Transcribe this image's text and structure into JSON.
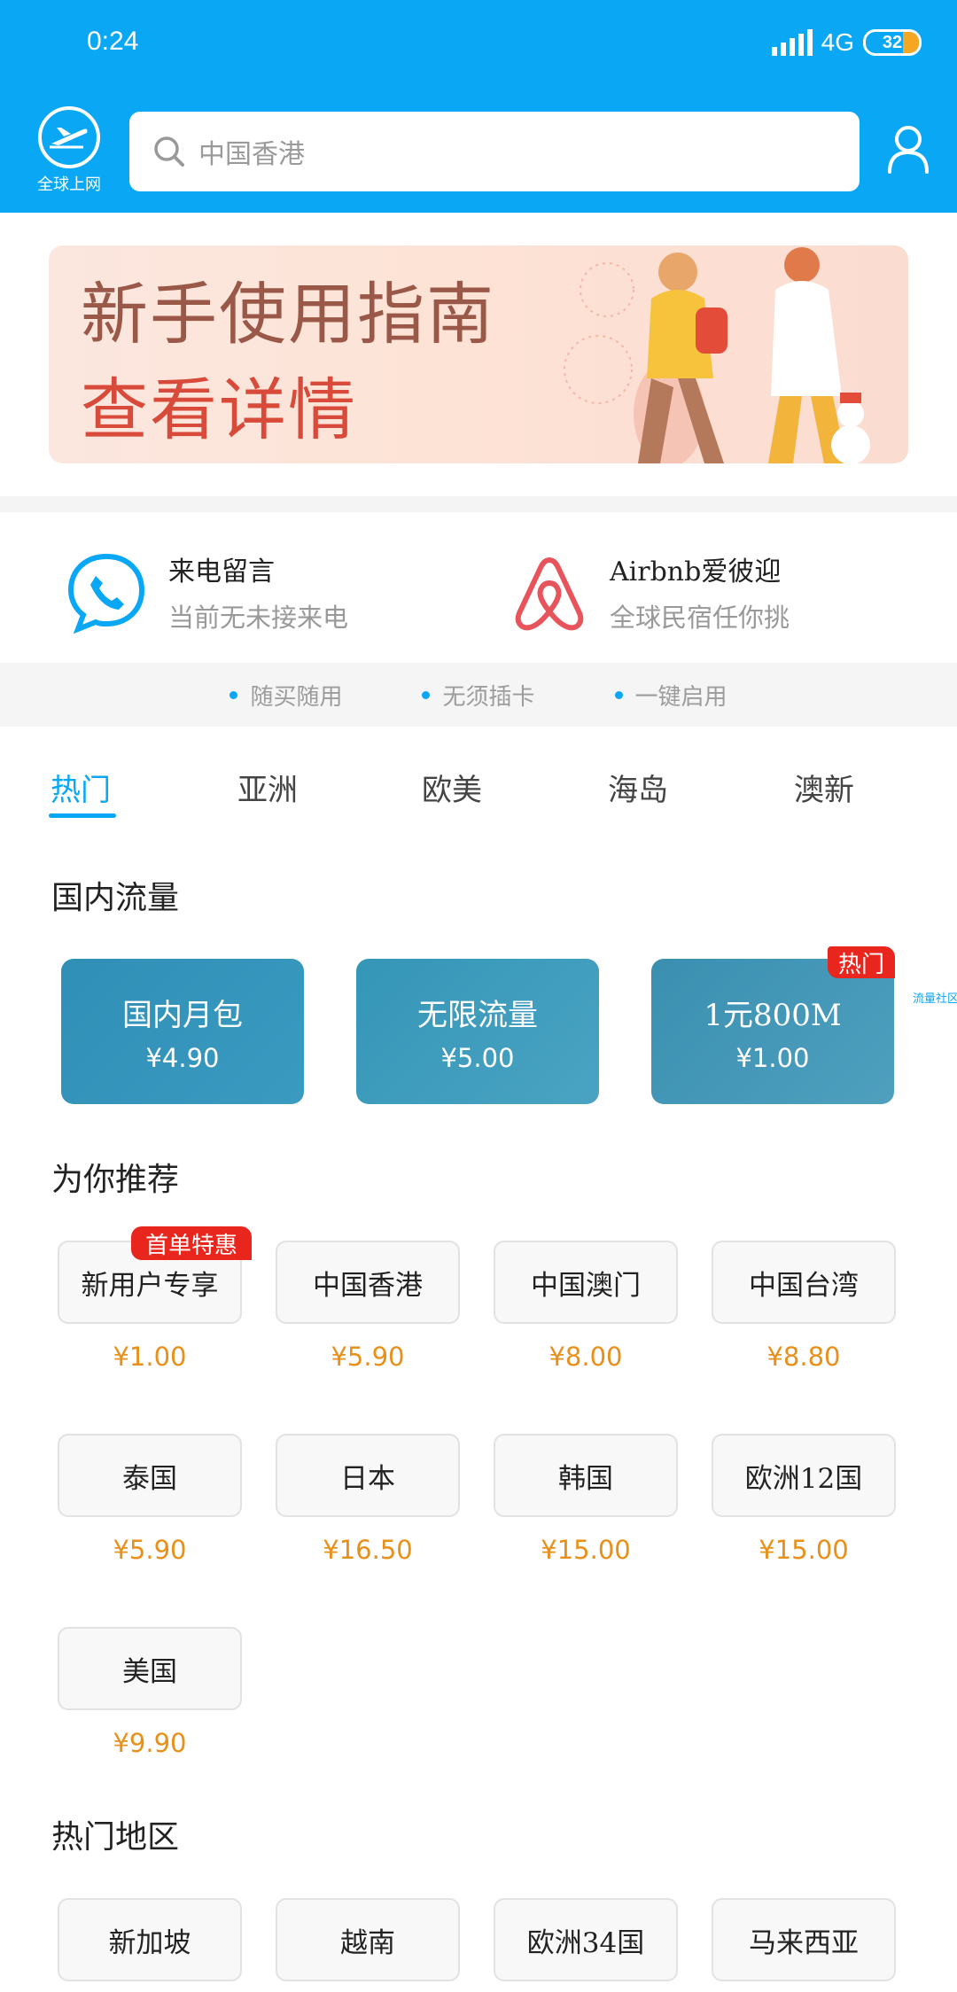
{
  "status_bar": {
    "time": "0:24",
    "network": "4G",
    "battery": "32"
  },
  "header": {
    "logo_label": "全球上网",
    "search_placeholder": "中国香港"
  },
  "banner": {
    "title": "新手使用指南",
    "subtitle": "查看详情"
  },
  "services": [
    {
      "title": "来电留言",
      "subtitle": "当前无未接来电",
      "icon": "phone-bubble-icon"
    },
    {
      "title": "Airbnb爱彼迎",
      "subtitle": "全球民宿任你挑",
      "icon": "airbnb-icon"
    }
  ],
  "features": [
    "随买随用",
    "无须插卡",
    "一键启用"
  ],
  "tabs": [
    "热门",
    "亚洲",
    "欧美",
    "海岛",
    "澳新"
  ],
  "domestic": {
    "title": "国内流量",
    "cards": [
      {
        "name": "国内月包",
        "price": "¥4.90"
      },
      {
        "name": "无限流量",
        "price": "¥5.00"
      },
      {
        "name": "1元800M",
        "price": "¥1.00"
      }
    ],
    "hot_tag": "热门",
    "side_link": "流量社区"
  },
  "recommend": {
    "title": "为你推荐",
    "first_tag": "首单特惠",
    "items": [
      {
        "name": "新用户专享",
        "price": "¥1.00"
      },
      {
        "name": "中国香港",
        "price": "¥5.90"
      },
      {
        "name": "中国澳门",
        "price": "¥8.00"
      },
      {
        "name": "中国台湾",
        "price": "¥8.80"
      },
      {
        "name": "泰国",
        "price": "¥5.90"
      },
      {
        "name": "日本",
        "price": "¥16.50"
      },
      {
        "name": "韩国",
        "price": "¥15.00"
      },
      {
        "name": "欧洲12国",
        "price": "¥15.00"
      },
      {
        "name": "美国",
        "price": "¥9.90"
      }
    ]
  },
  "hot_regions": {
    "title": "热门地区",
    "items": [
      "新加坡",
      "越南",
      "欧洲34国",
      "马来西亚"
    ]
  },
  "colors": {
    "primary": "#0aa7f4",
    "price": "#e8901a",
    "tag_red": "#e8261d"
  }
}
